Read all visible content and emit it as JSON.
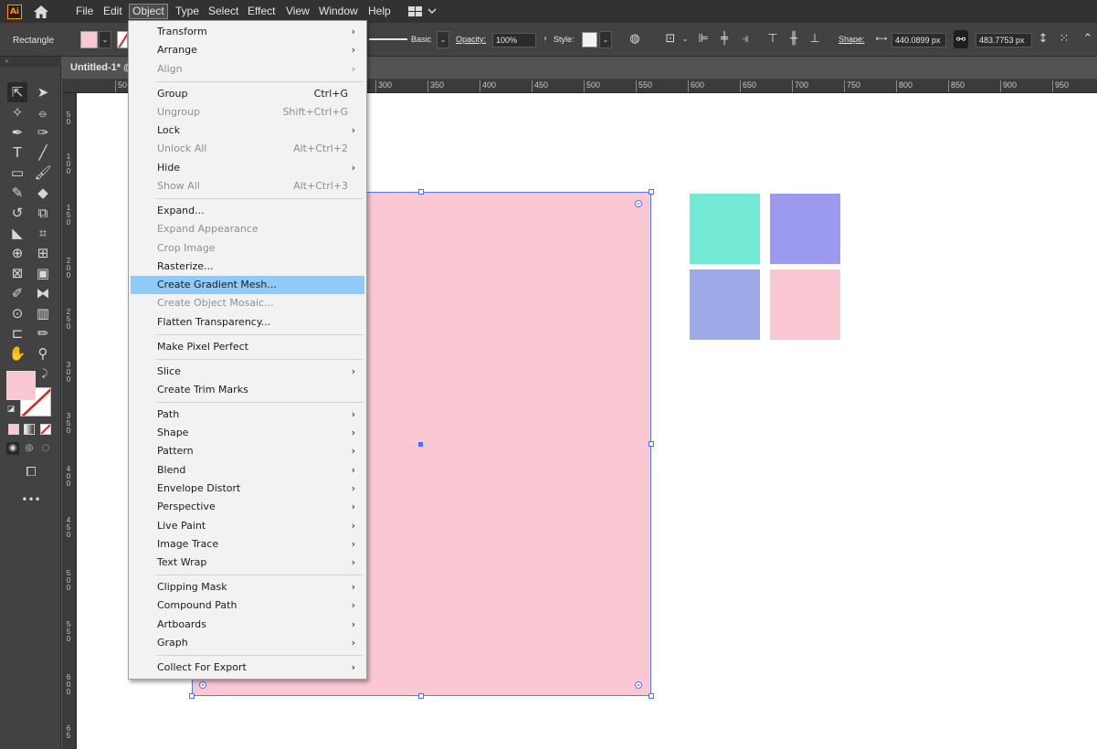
{
  "app": {
    "logo_text": "Ai"
  },
  "menubar": {
    "items": [
      "File",
      "Edit",
      "Object",
      "Type",
      "Select",
      "Effect",
      "View",
      "Window",
      "Help"
    ],
    "active": "Object"
  },
  "controlbar": {
    "selection_label": "Rectangle",
    "fill_color": "#f9c8d3",
    "stroke_profile": "Basic",
    "opacity_label": "Opacity:",
    "opacity_value": "100%",
    "style_label": "Style:",
    "shape_label": "Shape:",
    "width_value": "440.0899 px",
    "height_value": "483.7753 px"
  },
  "document": {
    "tab_title": "Untitled-1* @"
  },
  "ruler": {
    "h_ticks": [
      "50",
      "300",
      "350",
      "400",
      "450",
      "500",
      "550",
      "600",
      "650",
      "700",
      "750",
      "800",
      "850",
      "900",
      "950"
    ],
    "v_ticks": [
      "5\n0",
      "1\n0\n0",
      "1\n5\n0",
      "2\n0\n0",
      "2\n5\n0",
      "3\n0\n0",
      "3\n5\n0",
      "4\n0\n0",
      "4\n5\n0",
      "5\n0\n0",
      "5\n5\n0",
      "6\n0\n0",
      "6\n5"
    ]
  },
  "canvas": {
    "rect_color": "#f9c8d3",
    "tiles": [
      "#74ead6",
      "#9b9aee",
      "#9eaae8",
      "#f9c8d3"
    ]
  },
  "object_menu": {
    "items": [
      {
        "label": "Transform",
        "shortcut": "",
        "submenu": true,
        "disabled": false
      },
      {
        "label": "Arrange",
        "shortcut": "",
        "submenu": true,
        "disabled": false
      },
      {
        "label": "Align",
        "shortcut": "",
        "submenu": true,
        "disabled": true
      },
      {
        "label": "Group",
        "shortcut": "Ctrl+G",
        "submenu": false,
        "disabled": false
      },
      {
        "label": "Ungroup",
        "shortcut": "Shift+Ctrl+G",
        "submenu": false,
        "disabled": true
      },
      {
        "label": "Lock",
        "shortcut": "",
        "submenu": true,
        "disabled": false
      },
      {
        "label": "Unlock All",
        "shortcut": "Alt+Ctrl+2",
        "submenu": false,
        "disabled": true
      },
      {
        "label": "Hide",
        "shortcut": "",
        "submenu": true,
        "disabled": false
      },
      {
        "label": "Show All",
        "shortcut": "Alt+Ctrl+3",
        "submenu": false,
        "disabled": true
      },
      {
        "label": "Expand...",
        "shortcut": "",
        "submenu": false,
        "disabled": false
      },
      {
        "label": "Expand Appearance",
        "shortcut": "",
        "submenu": false,
        "disabled": true
      },
      {
        "label": "Crop Image",
        "shortcut": "",
        "submenu": false,
        "disabled": true
      },
      {
        "label": "Rasterize...",
        "shortcut": "",
        "submenu": false,
        "disabled": false
      },
      {
        "label": "Create Gradient Mesh...",
        "shortcut": "",
        "submenu": false,
        "disabled": false,
        "highlighted": true
      },
      {
        "label": "Create Object Mosaic...",
        "shortcut": "",
        "submenu": false,
        "disabled": true
      },
      {
        "label": "Flatten Transparency...",
        "shortcut": "",
        "submenu": false,
        "disabled": false
      },
      {
        "label": "Make Pixel Perfect",
        "shortcut": "",
        "submenu": false,
        "disabled": false
      },
      {
        "label": "Slice",
        "shortcut": "",
        "submenu": true,
        "disabled": false
      },
      {
        "label": "Create Trim Marks",
        "shortcut": "",
        "submenu": false,
        "disabled": false
      },
      {
        "label": "Path",
        "shortcut": "",
        "submenu": true,
        "disabled": false
      },
      {
        "label": "Shape",
        "shortcut": "",
        "submenu": true,
        "disabled": false
      },
      {
        "label": "Pattern",
        "shortcut": "",
        "submenu": true,
        "disabled": false
      },
      {
        "label": "Blend",
        "shortcut": "",
        "submenu": true,
        "disabled": false
      },
      {
        "label": "Envelope Distort",
        "shortcut": "",
        "submenu": true,
        "disabled": false
      },
      {
        "label": "Perspective",
        "shortcut": "",
        "submenu": true,
        "disabled": false
      },
      {
        "label": "Live Paint",
        "shortcut": "",
        "submenu": true,
        "disabled": false
      },
      {
        "label": "Image Trace",
        "shortcut": "",
        "submenu": true,
        "disabled": false
      },
      {
        "label": "Text Wrap",
        "shortcut": "",
        "submenu": true,
        "disabled": false
      },
      {
        "label": "Clipping Mask",
        "shortcut": "",
        "submenu": true,
        "disabled": false
      },
      {
        "label": "Compound Path",
        "shortcut": "",
        "submenu": true,
        "disabled": false
      },
      {
        "label": "Artboards",
        "shortcut": "",
        "submenu": true,
        "disabled": false
      },
      {
        "label": "Graph",
        "shortcut": "",
        "submenu": true,
        "disabled": false
      },
      {
        "label": "Collect For Export",
        "shortcut": "",
        "submenu": true,
        "disabled": false
      }
    ]
  }
}
